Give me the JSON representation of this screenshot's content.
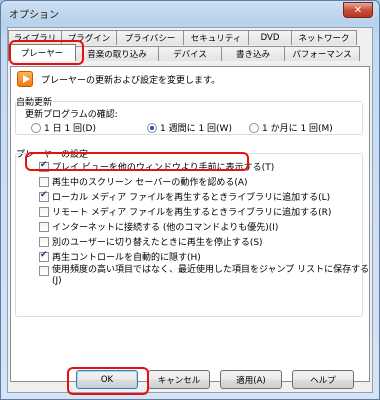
{
  "window": {
    "title": "オプション",
    "close_symbol": "✕"
  },
  "tabs": {
    "row1": [
      "ライブラリ",
      "プラグイン",
      "プライバシー",
      "セキュリティ",
      "DVD",
      "ネットワーク"
    ],
    "row2": [
      "プレーヤー",
      "音楽の取り込み",
      "デバイス",
      "書き込み",
      "パフォーマンス"
    ]
  },
  "header": {
    "text": "プレーヤーの更新および設定を変更します。"
  },
  "auto_update": {
    "title": "自動更新",
    "check_label": "更新プログラムの確認:",
    "options": [
      {
        "label": "1 日 1 回(D)",
        "checked": false
      },
      {
        "label": "1 週間に 1 回(W)",
        "checked": true
      },
      {
        "label": "1 か月に 1 回(M)",
        "checked": false
      }
    ]
  },
  "player_settings": {
    "title": "プレーヤーの設定",
    "items": [
      {
        "label": "プレイ ビューを他のウィンドウより手前に表示する(T)",
        "checked": true
      },
      {
        "label": "再生中のスクリーン セーバーの動作を認める(A)",
        "checked": false
      },
      {
        "label": "ローカル メディア ファイルを再生するときライブラリに追加する(L)",
        "checked": true
      },
      {
        "label": "リモート メディア ファイルを再生するときライブラリに追加する(R)",
        "checked": false
      },
      {
        "label": "インターネットに接続する (他のコマンドよりも優先)(I)",
        "checked": false
      },
      {
        "label": "別のユーザーに切り替えたときに再生を停止する(S)",
        "checked": false
      },
      {
        "label": "再生コントロールを自動的に隠す(H)",
        "checked": true
      },
      {
        "label": "使用頻度の高い項目ではなく、最近使用した項目をジャンプ リストに保存する",
        "label2": "(J)",
        "checked": false
      }
    ]
  },
  "buttons": {
    "ok": "OK",
    "cancel": "キャンセル",
    "apply": "適用(A)",
    "help": "ヘルプ"
  },
  "highlight_color": "#e8100c"
}
